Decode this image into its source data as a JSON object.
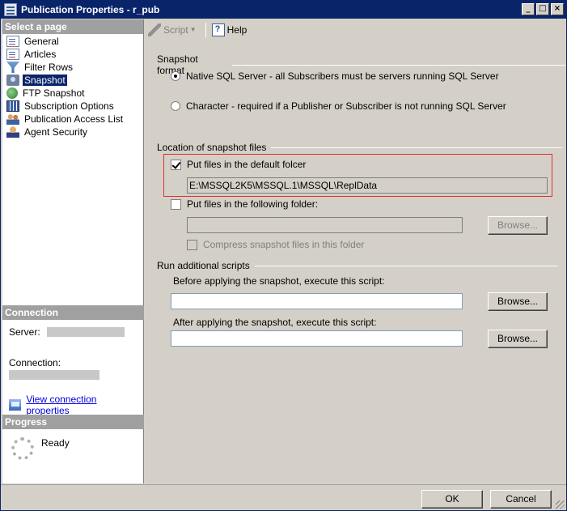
{
  "window": {
    "title": "Publication Properties - r_pub"
  },
  "left_pane": {
    "select_page_header": "Select a page",
    "pages": [
      {
        "label": "General",
        "icon": "general-icon"
      },
      {
        "label": "Articles",
        "icon": "articles-icon"
      },
      {
        "label": "Filter Rows",
        "icon": "filter-icon"
      },
      {
        "label": "Snapshot",
        "icon": "snapshot-icon",
        "selected": true
      },
      {
        "label": "FTP Snapshot",
        "icon": "ftp-icon"
      },
      {
        "label": "Subscription Options",
        "icon": "subscription-icon"
      },
      {
        "label": "Publication Access List",
        "icon": "access-list-icon"
      },
      {
        "label": "Agent Security",
        "icon": "agent-icon"
      }
    ],
    "connection": {
      "header": "Connection",
      "server_label": "Server:",
      "connection_label": "Connection:",
      "view_link": "View connection properties"
    },
    "progress": {
      "header": "Progress",
      "status": "Ready"
    }
  },
  "toolbar": {
    "script_label": "Script",
    "help_label": "Help"
  },
  "snapshot_format": {
    "header": "Snapshot format",
    "native_label": "Native SQL Server - all Subscribers must be servers running SQL Server",
    "character_label": "Character - required if a Publisher or Subscriber is not running SQL Server"
  },
  "location": {
    "header": "Location of snapshot files",
    "default_folder_label": "Put files in the default folcer",
    "default_folder_path": "E:\\MSSQL2K5\\MSSQL.1\\MSSQL\\ReplData",
    "following_folder_label": "Put files in the following folder:",
    "following_folder_value": "",
    "browse_label": "Browse...",
    "compress_label": "Compress snapshot files in this folder"
  },
  "scripts": {
    "header": "Run additional scripts",
    "before_label": "Before applying the snapshot, execute this script:",
    "before_value": "",
    "after_label": "After applying the snapshot, execute this script:",
    "after_value": "",
    "browse_label": "Browse..."
  },
  "footer": {
    "ok_label": "OK",
    "cancel_label": "Cancel"
  }
}
